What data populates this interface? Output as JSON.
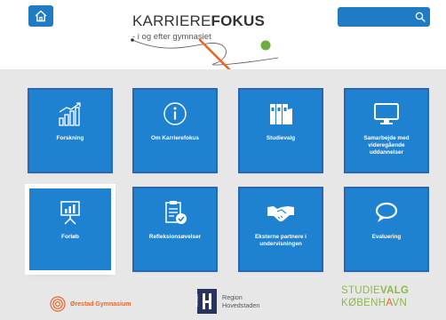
{
  "header": {
    "logo_title_light": "KARRIERE",
    "logo_title_bold": "FOKUS",
    "logo_subtitle": "- i og efter gymnasiet",
    "search_placeholder": ""
  },
  "tiles": [
    {
      "label": "Forskning",
      "icon": "bar-chart-growth-icon"
    },
    {
      "label": "Om Karrierefokus",
      "icon": "info-icon"
    },
    {
      "label": "Studievalg",
      "icon": "binders-icon"
    },
    {
      "label": "Samarbejde med videregående uddannelser",
      "icon": "monitor-icon"
    },
    {
      "label": "Forløb",
      "icon": "presentation-icon"
    },
    {
      "label": "Refleksionsøvelser",
      "icon": "checklist-icon"
    },
    {
      "label": "Eksterne partnere i undervisningen",
      "icon": "handshake-icon"
    },
    {
      "label": "Evaluering",
      "icon": "speech-bubble-icon"
    }
  ],
  "footer": {
    "orestad": "Ørestad Gymnasium",
    "region_line1": "Region",
    "region_line2": "Hovedstaden",
    "region_vertical": "REGION",
    "studievalg_line1_a": "STUDIE",
    "studievalg_line1_b": "VALG",
    "studievalg_line2_a": "KØBENH",
    "studievalg_line2_b": "A",
    "studievalg_line2_c": "VN"
  },
  "colors": {
    "tile_blue": "#1f82d0",
    "tile_border": "#2b66b3",
    "header_blue": "#1f7cc4",
    "accent_orange": "#e8672c",
    "accent_green": "#6cae3f"
  }
}
